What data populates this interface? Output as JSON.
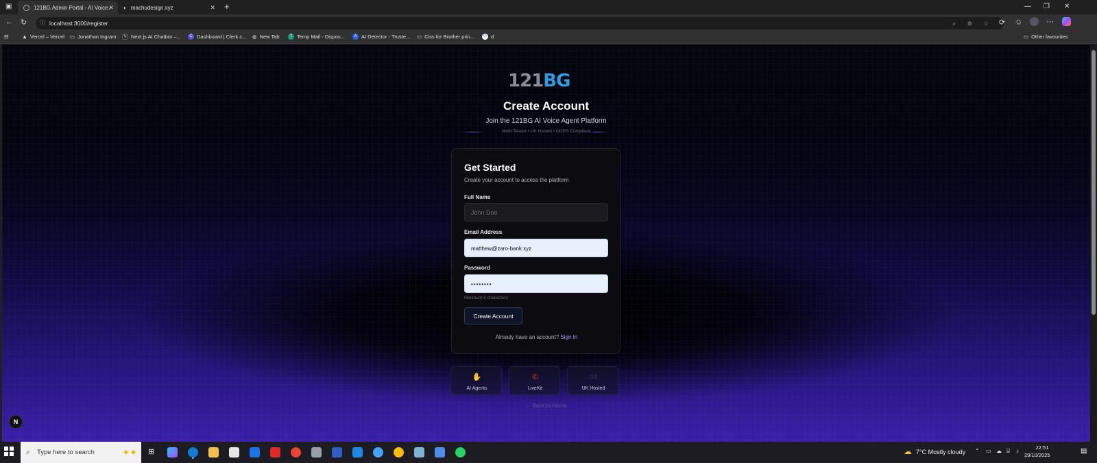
{
  "browser": {
    "tabs": [
      {
        "title": "121BG Admin Portal - AI Voice A",
        "active": true
      },
      {
        "title": "machudesign.xyz",
        "active": false
      }
    ],
    "new_tab_symbol": "+",
    "url": "localhost:3000/register",
    "bookmarks": [
      {
        "label": "Vercel – Vercel",
        "icon": "vercel-icon"
      },
      {
        "label": "Jonathan Ingram",
        "icon": "folder-icon"
      },
      {
        "label": "Next.js AI Chatbot –...",
        "icon": "nextjs-icon"
      },
      {
        "label": "Dashboard | Clerk.c...",
        "icon": "clerk-icon"
      },
      {
        "label": "New Tab",
        "icon": "globe-icon"
      },
      {
        "label": "Temp Mail - Dispos...",
        "icon": "tempmail-icon"
      },
      {
        "label": "AI Detector - Truste...",
        "icon": "detector-icon"
      },
      {
        "label": "Ciss for Brother prin...",
        "icon": "folder-icon"
      },
      {
        "label": "d",
        "icon": "google-icon"
      }
    ],
    "other_favourites": "Other favourites"
  },
  "page": {
    "logo": {
      "part1": "121",
      "part2": "BG"
    },
    "title": "Create Account",
    "subtitle": "Join the 121BG AI Voice Agent Platform",
    "tagline": "Multi-Tenant • UK Hosted • GDPR Compliant",
    "card": {
      "heading": "Get Started",
      "description": "Create your account to access the platform",
      "full_name_label": "Full Name",
      "full_name_placeholder": "John Doe",
      "email_label": "Email Address",
      "email_value": "matthew@zaro-bank.xyz",
      "password_label": "Password",
      "password_value": "••••••••",
      "password_hint": "Minimum 6 characters",
      "submit_label": "Create Account",
      "signin_prompt": "Already have an account?",
      "signin_link": "Sign In"
    },
    "features": [
      {
        "label": "AI Agents",
        "icon": "brain-icon"
      },
      {
        "label": "LiveKit",
        "icon": "phone-icon"
      },
      {
        "label": "UK Hosted",
        "icon": "gb-flag-icon",
        "text": "GB"
      }
    ],
    "back_link": "← Back to Home",
    "next_badge": "N"
  },
  "taskbar": {
    "search_placeholder": "Type here to search",
    "weather": "7°C  Mostly cloudy",
    "time": "22:51",
    "date": "29/10/2025"
  },
  "colors": {
    "accent_blue": "#2f9be0",
    "link_purple": "#a899ff",
    "bg_purple": "#3a1fa8"
  }
}
